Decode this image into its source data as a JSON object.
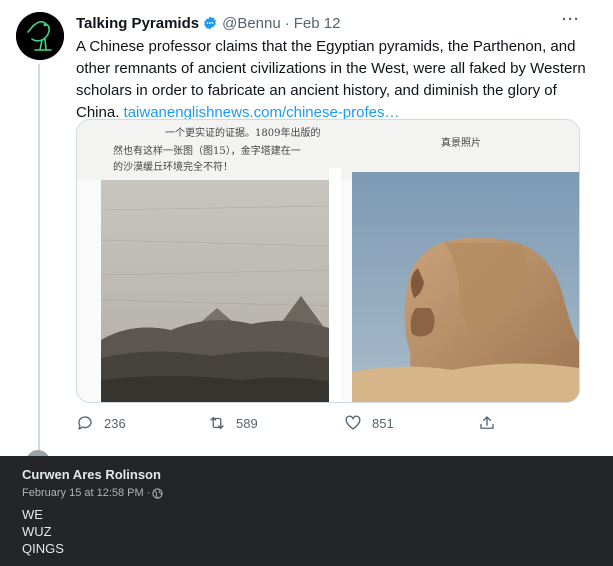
{
  "tweet": {
    "display_name": "Talking Pyramids",
    "verified_icon": "verified-badge-icon",
    "handle": "@Bennu",
    "separator": "·",
    "date": "Feb 12",
    "more_icon": "more-icon",
    "more_label": "···",
    "text": "A Chinese professor claims that the Egyptian pyramids, the Parthenon, and other remnants of ancient civilizations in the West, were all faked by Western scholars in order to fabricate an ancient history, and diminish the glory of China. ",
    "link_text": "taiwanenglishnews.com/chinese-profes…",
    "accent_color": "#1d9bf0",
    "media": {
      "scan_text_1": "一个更实证的证据。1809年出版的",
      "scan_text_2": "然也有这样一张图（图15），金字塔建在一",
      "scan_text_3": "的沙漠缓丘环境完全不符！",
      "scan_text_right": "真景照片",
      "left_image": "pyramids-engraving",
      "right_image": "sphinx-photo"
    },
    "actions": {
      "reply_count": "236",
      "retweet_count": "589",
      "like_count": "851"
    }
  },
  "comment": {
    "author": "Curwen Ares Rolinson",
    "timestamp": "February 15 at 12:58 PM · ",
    "privacy_icon": "globe-icon",
    "lines": [
      "WE",
      "WUZ",
      "QINGS"
    ],
    "background": "#242526"
  }
}
